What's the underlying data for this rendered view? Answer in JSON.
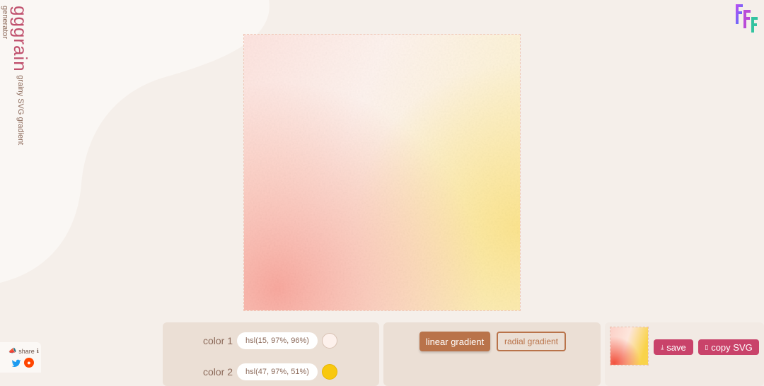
{
  "app": {
    "title": "gggrain",
    "subtitle": "grainy SVG gradient generator"
  },
  "colors": {
    "primary_pink": "#c9436a",
    "accent_brown": "#b9734a",
    "text_brown": "#8c6a5a"
  },
  "gradient": {
    "type": "linear",
    "color1": "hsl(15, 97%, 96%)",
    "color2": "hsl(47, 97%, 51%)"
  },
  "controls": {
    "color1_label": "color 1",
    "color1_value": "hsl(15, 97%, 96%)",
    "color2_label": "color 2",
    "color2_value": "hsl(47, 97%, 51%)"
  },
  "type_buttons": {
    "linear_label": "linear gradient",
    "radial_label": "radial gradient"
  },
  "export": {
    "save_label": "save",
    "copy_label": "copy SVG"
  },
  "share": {
    "label": "share",
    "icons": [
      "twitter-icon",
      "reddit-icon"
    ]
  },
  "logo": {
    "text": "FFF"
  }
}
